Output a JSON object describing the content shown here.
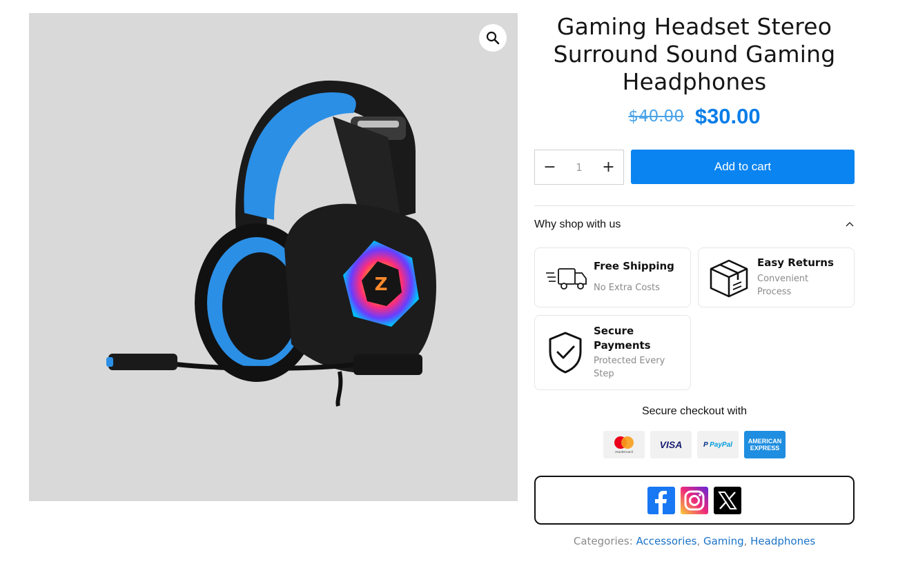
{
  "product": {
    "title": "Gaming Headset Stereo Surround Sound Gaming Headphones",
    "price_old": "$40.00",
    "price_new": "$30.00"
  },
  "gallery": {
    "zoom_icon": "magnifier-icon",
    "image_alt": "gaming-headset-image"
  },
  "cart": {
    "qty_minus": "−",
    "qty_value": "1",
    "qty_plus": "+",
    "add_label": "Add to cart"
  },
  "why": {
    "label": "Why shop with us",
    "badges": [
      {
        "title": "Free Shipping",
        "subtitle": "No Extra Costs",
        "icon": "truck-icon"
      },
      {
        "title": "Easy Returns",
        "subtitle": "Convenient Process",
        "icon": "box-icon"
      },
      {
        "title": "Secure Payments",
        "subtitle": "Protected Every Step",
        "icon": "shield-check-icon"
      }
    ]
  },
  "checkout": {
    "label": "Secure checkout with",
    "methods": [
      "mastercard",
      "VISA",
      "PayPal",
      "AMERICAN EXPRESS"
    ]
  },
  "social": [
    "facebook-icon",
    "instagram-icon",
    "x-icon"
  ],
  "categories": {
    "label": "Categories:",
    "items": [
      "Accessories",
      "Gaming",
      "Headphones"
    ]
  },
  "colors": {
    "accent": "#0a84f0",
    "price": "#0a7de8",
    "old_price": "#4aa3e8",
    "link": "#1a73c8"
  }
}
